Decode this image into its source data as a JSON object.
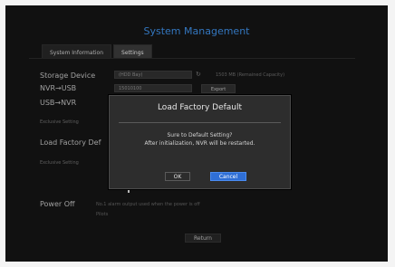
{
  "screen": {
    "title": "System Management",
    "tabs": [
      {
        "label": "System Information"
      },
      {
        "label": "Settings"
      }
    ],
    "storage_device": {
      "label": "Storage Device",
      "value": "(HDD Bay)",
      "capacity": "1503 MB (Remained Capacity)"
    },
    "nvr_usb": {
      "label": "NVR→USB",
      "value": "15010100",
      "button": "Export"
    },
    "usb_nvr": {
      "label": "USB→NVR"
    },
    "exclusive_setting_1": "Exclusive Setting",
    "load_factory": {
      "label": "Load Factory Def"
    },
    "exclusive_setting_2": "Exclusive Setting",
    "power_off": {
      "label": "Power Off",
      "note": "No.1 alarm output used when the power is off",
      "note2": "Pilots"
    },
    "return_label": "Return"
  },
  "dialog": {
    "title": "Load Factory Default",
    "message_line1": "Sure to Default Setting?",
    "message_line2": "After initialization, NVR will be restarted.",
    "ok": "OK",
    "cancel": "Cancel"
  },
  "colors": {
    "accent_blue": "#3d8be0",
    "primary_button": "#2f6fd6"
  }
}
